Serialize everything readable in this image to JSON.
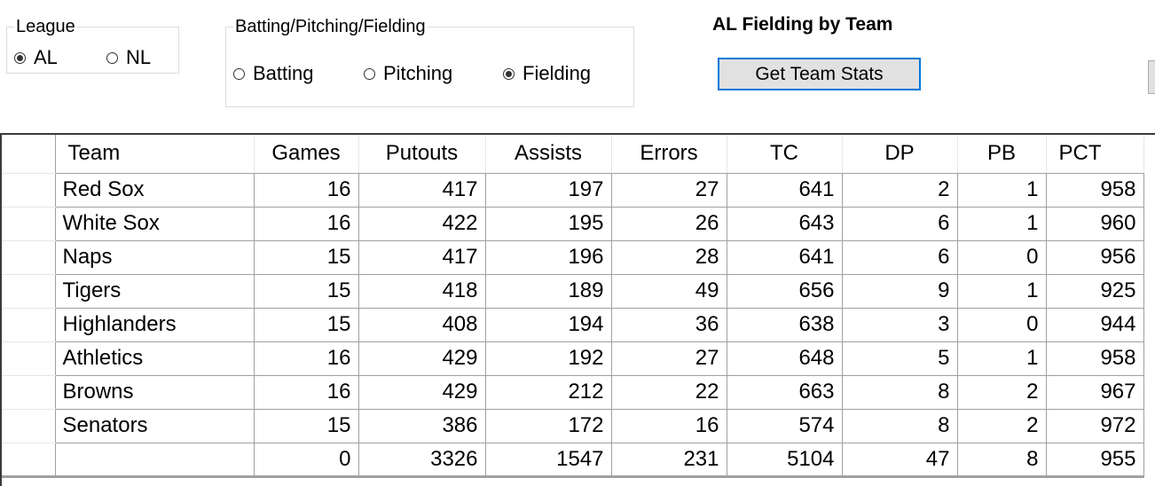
{
  "league_group": {
    "label": "League",
    "options": [
      {
        "label": "AL",
        "checked": true
      },
      {
        "label": "NL",
        "checked": false
      }
    ]
  },
  "type_group": {
    "label": "Batting/Pitching/Fielding",
    "options": [
      {
        "label": "Batting",
        "checked": false
      },
      {
        "label": "Pitching",
        "checked": false
      },
      {
        "label": "Fielding",
        "checked": true
      }
    ]
  },
  "title": "AL Fielding by Team",
  "get_stats_button": "Get Team Stats",
  "grid": {
    "columns": [
      "Team",
      "Games",
      "Putouts",
      "Assists",
      "Errors",
      "TC",
      "DP",
      "PB",
      "PCT"
    ],
    "rows": [
      [
        "Red Sox",
        "16",
        "417",
        "197",
        "27",
        "641",
        "2",
        "1",
        "958"
      ],
      [
        "White Sox",
        "16",
        "422",
        "195",
        "26",
        "643",
        "6",
        "1",
        "960"
      ],
      [
        "Naps",
        "15",
        "417",
        "196",
        "28",
        "641",
        "6",
        "0",
        "956"
      ],
      [
        "Tigers",
        "15",
        "418",
        "189",
        "49",
        "656",
        "9",
        "1",
        "925"
      ],
      [
        "Highlanders",
        "15",
        "408",
        "194",
        "36",
        "638",
        "3",
        "0",
        "944"
      ],
      [
        "Athletics",
        "16",
        "429",
        "192",
        "27",
        "648",
        "5",
        "1",
        "958"
      ],
      [
        "Browns",
        "16",
        "429",
        "212",
        "22",
        "663",
        "8",
        "2",
        "967"
      ],
      [
        "Senators",
        "15",
        "386",
        "172",
        "16",
        "574",
        "8",
        "2",
        "972"
      ],
      [
        "",
        "0",
        "3326",
        "1547",
        "231",
        "5104",
        "47",
        "8",
        "955"
      ]
    ]
  }
}
